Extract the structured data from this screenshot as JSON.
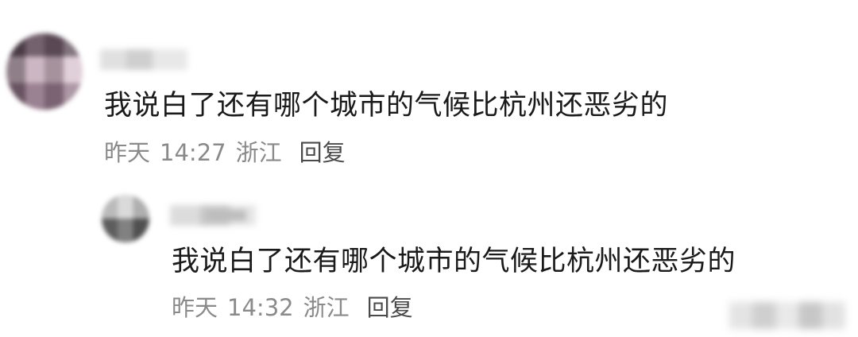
{
  "comments": [
    {
      "text": "我说白了还有哪个城市的气候比杭州还恶劣的",
      "date_label": "昨天",
      "time": "14:27",
      "location": "浙江",
      "reply_label": "回复"
    },
    {
      "text": "我说白了还有哪个城市的气候比杭州还恶劣的",
      "date_label": "昨天",
      "time": "14:32",
      "location": "浙江",
      "reply_label": "回复"
    }
  ]
}
